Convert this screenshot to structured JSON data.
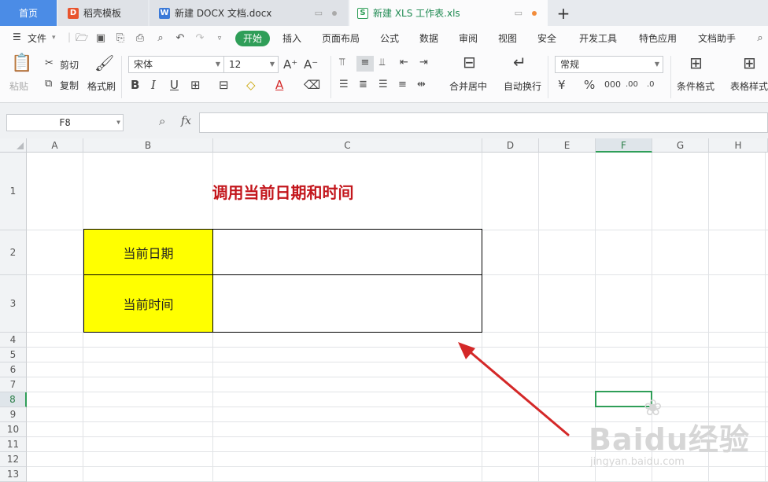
{
  "tabs": {
    "home": "首页",
    "daoke": "稻壳模板",
    "docx": "新建 DOCX 文档.docx",
    "xls": "新建 XLS 工作表.xls",
    "add": "+"
  },
  "menu": {
    "file": "文件",
    "start": "开始",
    "insert": "插入",
    "page_layout": "页面布局",
    "formula": "公式",
    "data": "数据",
    "review": "审阅",
    "view": "视图",
    "security": "安全",
    "dev_tools": "开发工具",
    "special": "特色应用",
    "doc_helper": "文档助手"
  },
  "ribbon": {
    "paste": "粘贴",
    "cut": "剪切",
    "copy": "复制",
    "format_painter": "格式刷",
    "font_name": "宋体",
    "font_size": "12",
    "merge_center": "合并居中",
    "wrap_text": "自动换行",
    "number_format": "常规",
    "conditional_format": "条件格式",
    "table_style": "表格样式"
  },
  "formula_bar": {
    "name_box": "F8",
    "fx": "fx",
    "formula": ""
  },
  "sheet": {
    "columns": [
      "A",
      "B",
      "C",
      "D",
      "E",
      "F",
      "G",
      "H"
    ],
    "rows": [
      "1",
      "2",
      "3",
      "4",
      "5",
      "6",
      "7",
      "8",
      "9",
      "10",
      "11",
      "12",
      "13"
    ],
    "selected_column": "F",
    "selected_row": "8",
    "title": "调用当前日期和时间",
    "label_date": "当前日期",
    "label_time": "当前时间",
    "value_date": "",
    "value_time": ""
  },
  "watermark": {
    "main": "Baidu经验",
    "sub": "jingyan.baidu.com"
  },
  "colors": {
    "accent": "#2f9e58",
    "tab_home": "#4b8ce6",
    "title_red": "#c3161c",
    "label_fill": "#ffff00",
    "arrow": "#d42828"
  }
}
